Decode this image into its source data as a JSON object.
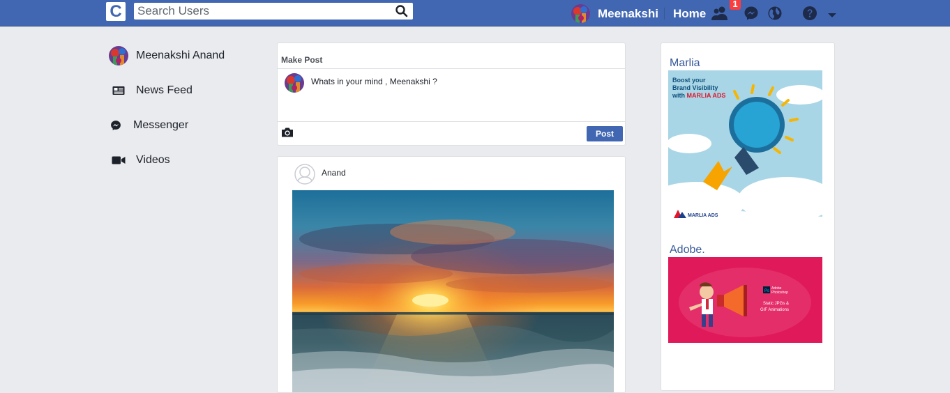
{
  "topbar": {
    "logo_letter": "C",
    "search_placeholder": "Search Users",
    "username": "Meenakshi",
    "home_label": "Home",
    "friend_requests_count": "1",
    "icons": [
      "search-icon",
      "friends-icon",
      "messenger-icon",
      "globe-icon",
      "help-icon",
      "caret-down-icon"
    ]
  },
  "left_nav": {
    "items": [
      {
        "label": "Meenakshi Anand",
        "icon": "avatar"
      },
      {
        "label": "News Feed",
        "icon": "newsfeed-icon"
      },
      {
        "label": "Messenger",
        "icon": "messenger-icon"
      },
      {
        "label": "Videos",
        "icon": "video-icon"
      }
    ]
  },
  "make_post": {
    "title": "Make Post",
    "placeholder": "Whats in your mind , Meenakshi ?",
    "post_button": "Post"
  },
  "feed": {
    "posts": [
      {
        "author": "Anand",
        "image": "sunset over sea"
      }
    ]
  },
  "ads": {
    "items": [
      {
        "title": "Marlia",
        "banner_line1": "Boost your",
        "banner_line2": "Brand Visibility",
        "banner_line3_prefix": "with ",
        "banner_line3_brand": "MARLIA ADS",
        "logo_text": "MARLIA ADS"
      },
      {
        "title": "Adobe.",
        "banner_app_line1": "Adobe",
        "banner_app_line2": "Photoshop",
        "banner_caption_line1": "Static JPGs &",
        "banner_caption_line2": "GIF Animations"
      }
    ]
  },
  "colors": {
    "topbar": "#4267b2",
    "background": "#e9ebee",
    "link": "#365899",
    "badge": "#fa3e3e"
  }
}
